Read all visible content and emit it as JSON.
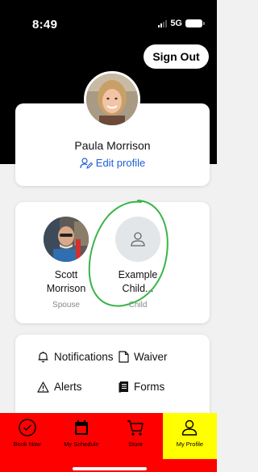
{
  "status_bar": {
    "time": "8:49",
    "network": "5G"
  },
  "header": {
    "sign_out_label": "Sign Out"
  },
  "profile": {
    "name": "Paula Morrison",
    "edit_label": "Edit profile"
  },
  "family": [
    {
      "name_line1": "Scott",
      "name_line2": "Morrison",
      "role": "Spouse",
      "avatar": "photo"
    },
    {
      "name_line1": "Example",
      "name_line2": "Child...",
      "role": "Child",
      "avatar": "person-icon"
    }
  ],
  "menu": {
    "notifications": "Notifications",
    "waiver": "Waiver",
    "alerts": "Alerts",
    "forms": "Forms"
  },
  "nav": {
    "items": [
      {
        "label": "Book Now",
        "icon": "check-circle-icon"
      },
      {
        "label": "My Schedule",
        "icon": "calendar-icon"
      },
      {
        "label": "Store",
        "icon": "cart-icon"
      },
      {
        "label": "My Profile",
        "icon": "person-icon"
      }
    ],
    "active_index": 3
  },
  "colors": {
    "nav_background": "#ff0000",
    "nav_active": "#ffff00",
    "link_blue": "#1f5fd6",
    "annotation_green": "#39b54a"
  }
}
